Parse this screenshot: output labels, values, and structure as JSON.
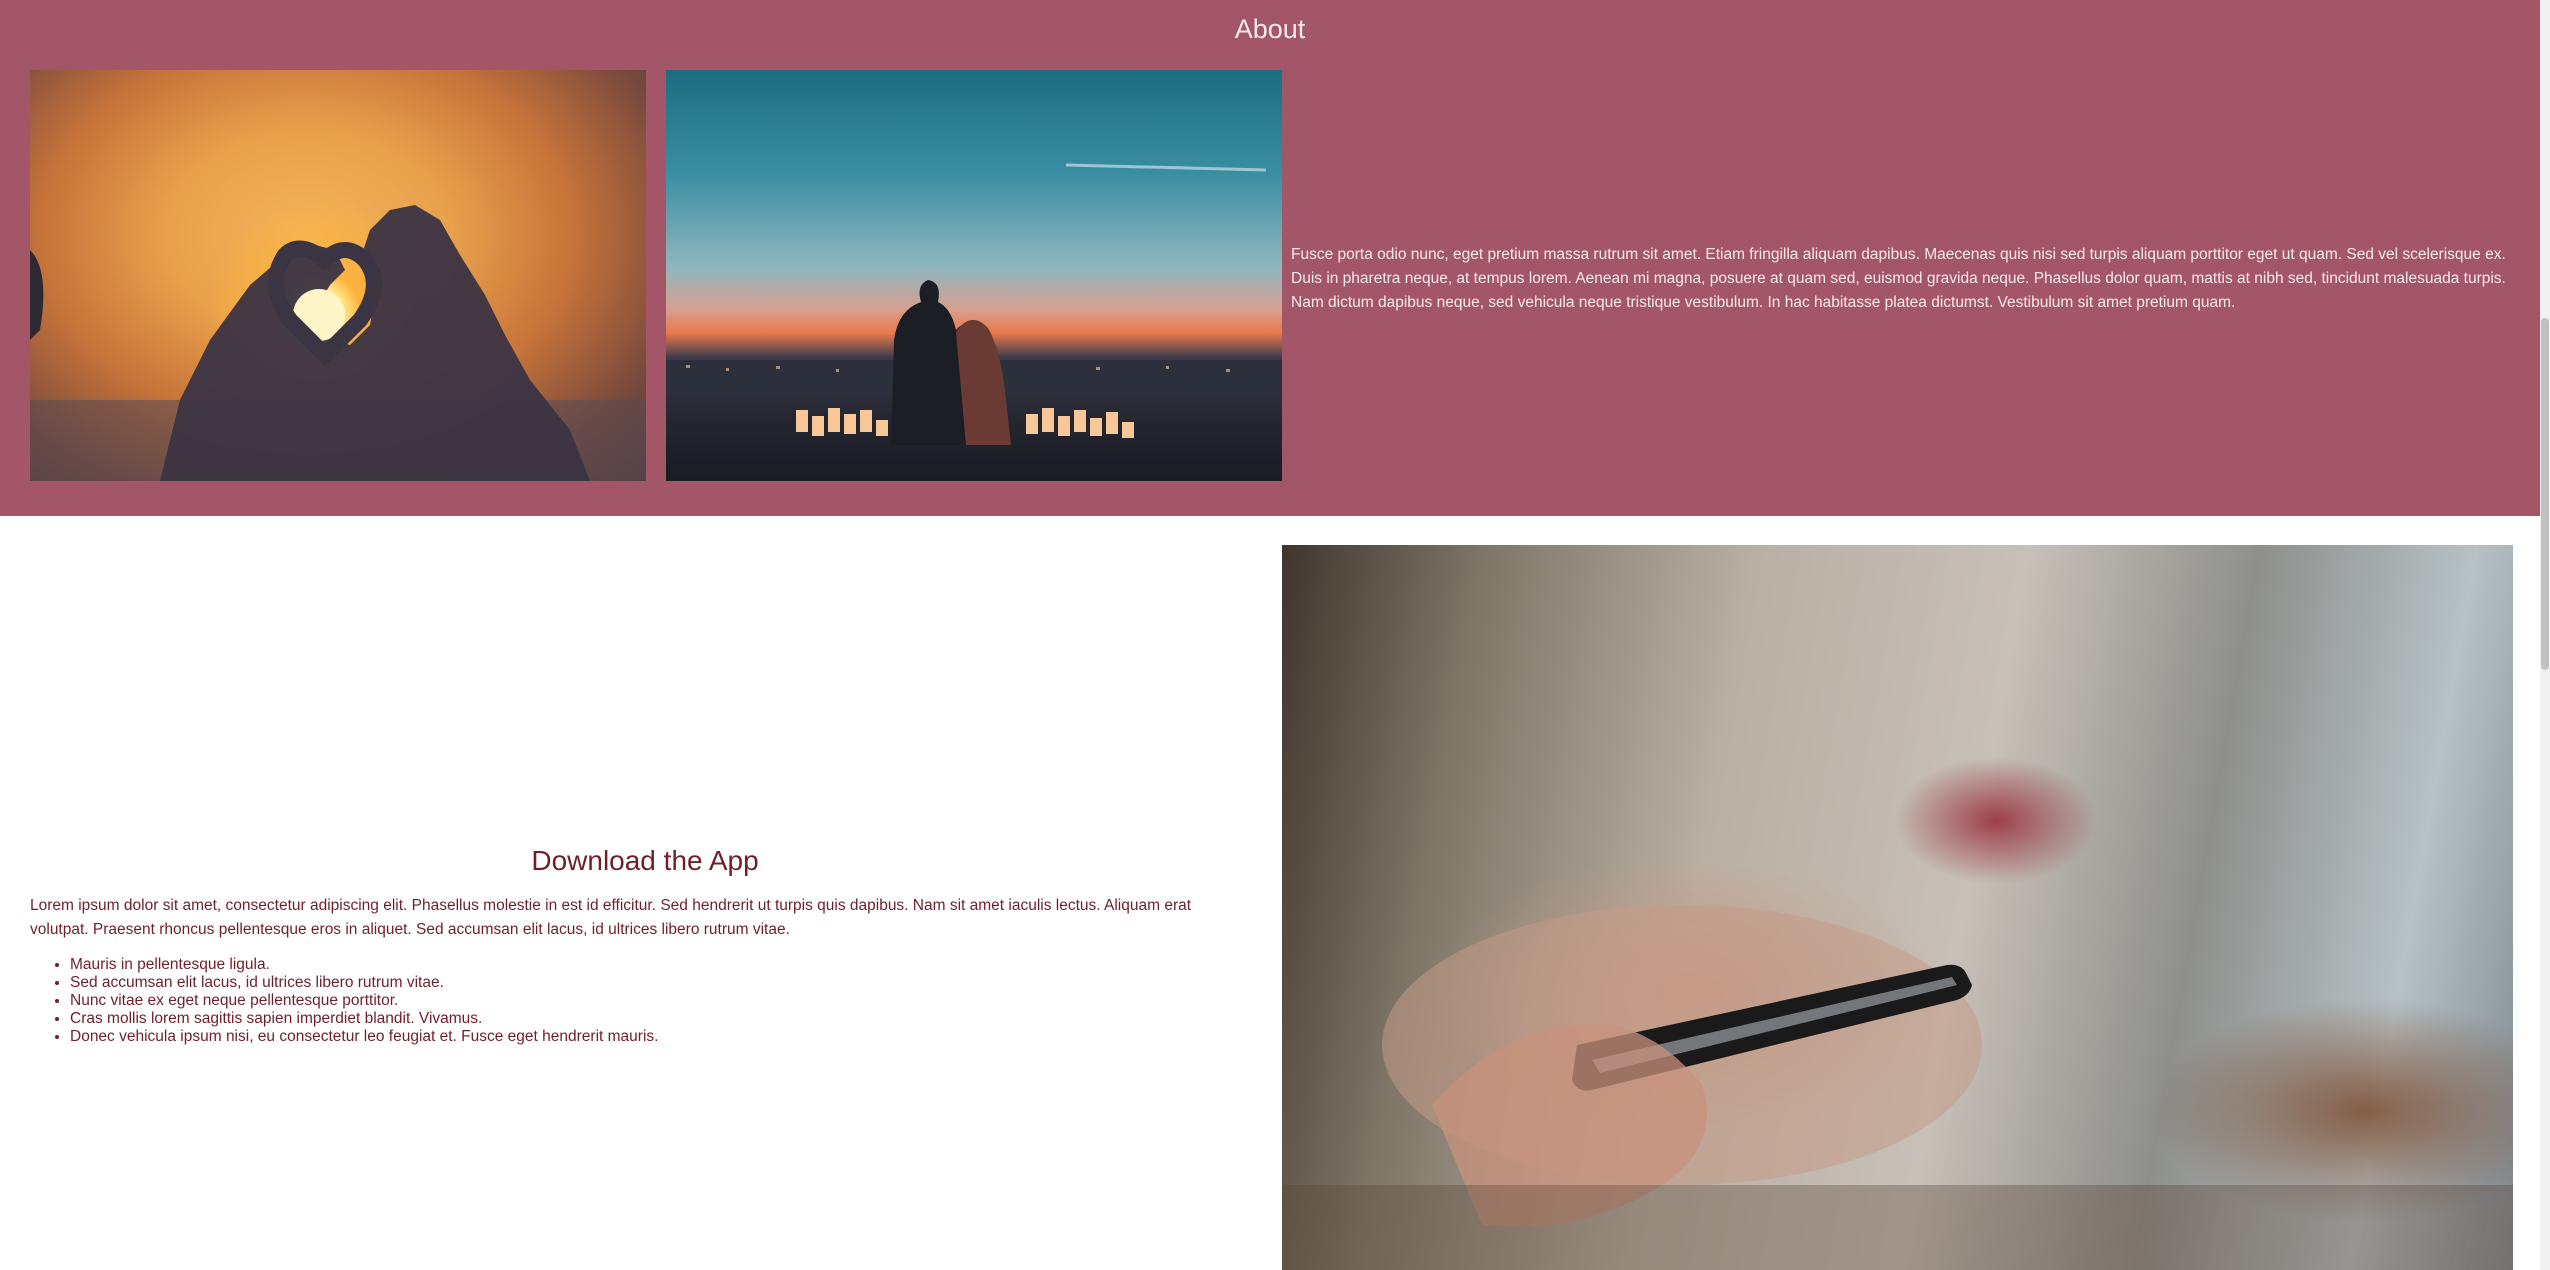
{
  "about": {
    "title": "About",
    "images": [
      {
        "icon": "heart-hands-sunset-photo"
      },
      {
        "icon": "couple-city-sunset-photo"
      }
    ],
    "text": "Fusce porta odio nunc, eget pretium massa rutrum sit amet. Etiam fringilla aliquam dapibus. Maecenas quis nisi sed turpis aliquam porttitor eget ut quam. Sed vel scelerisque ex. Duis in pharetra neque, at tempus lorem. Aenean mi magna, posuere at quam sed, euismod gravida neque. Phasellus dolor quam, mattis at nibh sed, tincidunt malesuada turpis. Nam dictum dapibus neque, sed vehicula neque tristique vestibulum. In hac habitasse platea dictumst. Vestibulum sit amet pretium quam."
  },
  "download": {
    "title": "Download the App",
    "text": "Lorem ipsum dolor sit amet, consectetur adipiscing elit. Phasellus molestie in est id efficitur. Sed hendrerit ut turpis quis dapibus. Nam sit amet iaculis lectus. Aliquam erat volutpat. Praesent rhoncus pellentesque eros in aliquet. Sed accumsan elit lacus, id ultrices libero rutrum vitae.",
    "list": [
      "Mauris in pellentesque ligula.",
      "Sed accumsan elit lacus, id ultrices libero rutrum vitae.",
      "Nunc vitae ex eget neque pellentesque porttitor.",
      "Cras mollis lorem sagittis sapien imperdiet blandit. Vivamus.",
      "Donec vehicula ipsum nisi, eu consectetur leo feugiat et. Fusce eget hendrerit mauris."
    ],
    "image": {
      "icon": "phone-in-hand-photo"
    }
  },
  "colors": {
    "about_background": "#a35667",
    "about_text": "#f6e9ec",
    "download_text": "#6e1f2d",
    "page_background": "#ffffff"
  }
}
